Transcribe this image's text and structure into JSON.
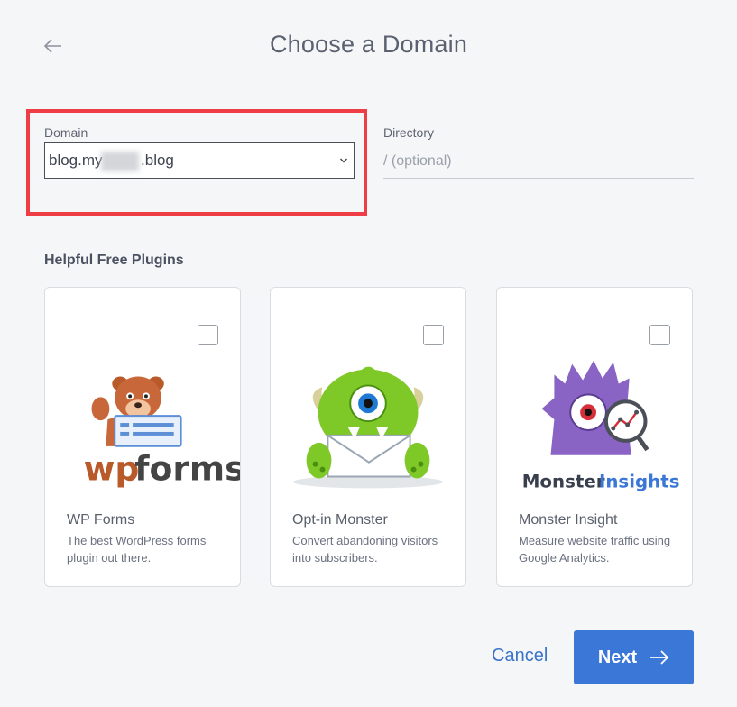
{
  "header": {
    "title": "Choose a Domain",
    "back_icon": "arrow-left-icon"
  },
  "domain": {
    "label": "Domain",
    "value": "blog.my   .blog"
  },
  "directory": {
    "label": "Directory",
    "placeholder": "/ (optional)"
  },
  "plugins": {
    "section_title": "Helpful Free Plugins",
    "cards": [
      {
        "name": "WP Forms",
        "desc": "The best WordPress forms plugin out there.",
        "logo_text_a": "wp",
        "logo_text_b": "forms",
        "checked": false
      },
      {
        "name": "Opt-in Monster",
        "desc": "Convert abandoning visitors into subscribers.",
        "checked": false
      },
      {
        "name": "Monster Insight",
        "desc": "Measure website traffic using Google Analytics.",
        "logo_text_a": "Monster",
        "logo_text_b": "Insights",
        "checked": false
      }
    ]
  },
  "footer": {
    "cancel_label": "Cancel",
    "next_label": "Next"
  },
  "colors": {
    "accent": "#3b77d6",
    "highlight": "#ef3d45",
    "background": "#f5f6f8"
  }
}
